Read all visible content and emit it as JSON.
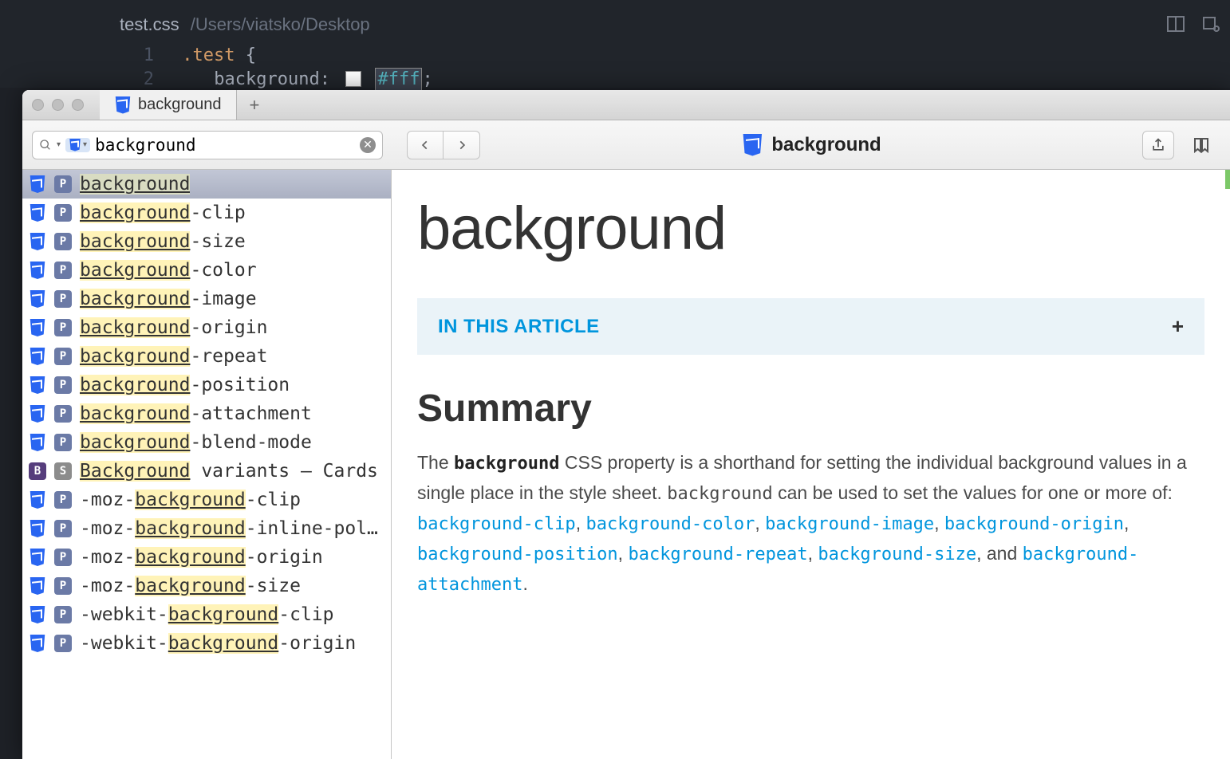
{
  "editor": {
    "filename": "test.css",
    "filepath": "/Users/viatsko/Desktop",
    "lines": [
      {
        "num": "1",
        "content_selector": ".test",
        "brace": "{"
      },
      {
        "num": "2",
        "prop": "background:",
        "value": "#fff"
      }
    ]
  },
  "window": {
    "tab_title": "background",
    "plus": "+"
  },
  "toolbar": {
    "search_value": "background",
    "page_title": "background"
  },
  "in_this_article": {
    "label": "IN THIS ARTICLE",
    "plus": "+"
  },
  "article": {
    "title": "background",
    "summary_heading": "Summary",
    "summary_before": "The ",
    "summary_kw": "background",
    "summary_mid1": " CSS property is a shorthand for setting the individual background values in a single place in the style sheet. ",
    "summary_kw2": "background",
    "summary_mid2": " can be used to set the values for one or more of: ",
    "and": ", and ",
    "period": ".",
    "links": [
      "background-clip",
      "background-color",
      "background-image",
      "background-origin",
      "background-position",
      "background-repeat",
      "background-size",
      "background-attachment"
    ]
  },
  "results": [
    {
      "badges": [
        "css",
        "p"
      ],
      "pre": "",
      "match": "background",
      "post": "",
      "selected": true
    },
    {
      "badges": [
        "css",
        "p"
      ],
      "pre": "",
      "match": "background",
      "post": "-clip"
    },
    {
      "badges": [
        "css",
        "p"
      ],
      "pre": "",
      "match": "background",
      "post": "-size"
    },
    {
      "badges": [
        "css",
        "p"
      ],
      "pre": "",
      "match": "background",
      "post": "-color"
    },
    {
      "badges": [
        "css",
        "p"
      ],
      "pre": "",
      "match": "background",
      "post": "-image"
    },
    {
      "badges": [
        "css",
        "p"
      ],
      "pre": "",
      "match": "background",
      "post": "-origin"
    },
    {
      "badges": [
        "css",
        "p"
      ],
      "pre": "",
      "match": "background",
      "post": "-repeat"
    },
    {
      "badges": [
        "css",
        "p"
      ],
      "pre": "",
      "match": "background",
      "post": "-position"
    },
    {
      "badges": [
        "css",
        "p"
      ],
      "pre": "",
      "match": "background",
      "post": "-attachment"
    },
    {
      "badges": [
        "css",
        "p"
      ],
      "pre": "",
      "match": "background",
      "post": "-blend-mode"
    },
    {
      "badges": [
        "b",
        "s"
      ],
      "pre": "",
      "match": "Background",
      "post": " variants — Cards"
    },
    {
      "badges": [
        "css",
        "p"
      ],
      "pre": "-moz-",
      "match": "background",
      "post": "-clip"
    },
    {
      "badges": [
        "css",
        "p"
      ],
      "pre": "-moz-",
      "match": "background",
      "post": "-inline-pol…"
    },
    {
      "badges": [
        "css",
        "p"
      ],
      "pre": "-moz-",
      "match": "background",
      "post": "-origin"
    },
    {
      "badges": [
        "css",
        "p"
      ],
      "pre": "-moz-",
      "match": "background",
      "post": "-size"
    },
    {
      "badges": [
        "css",
        "p"
      ],
      "pre": "-webkit-",
      "match": "background",
      "post": "-clip"
    },
    {
      "badges": [
        "css",
        "p"
      ],
      "pre": "-webkit-",
      "match": "background",
      "post": "-origin"
    }
  ]
}
